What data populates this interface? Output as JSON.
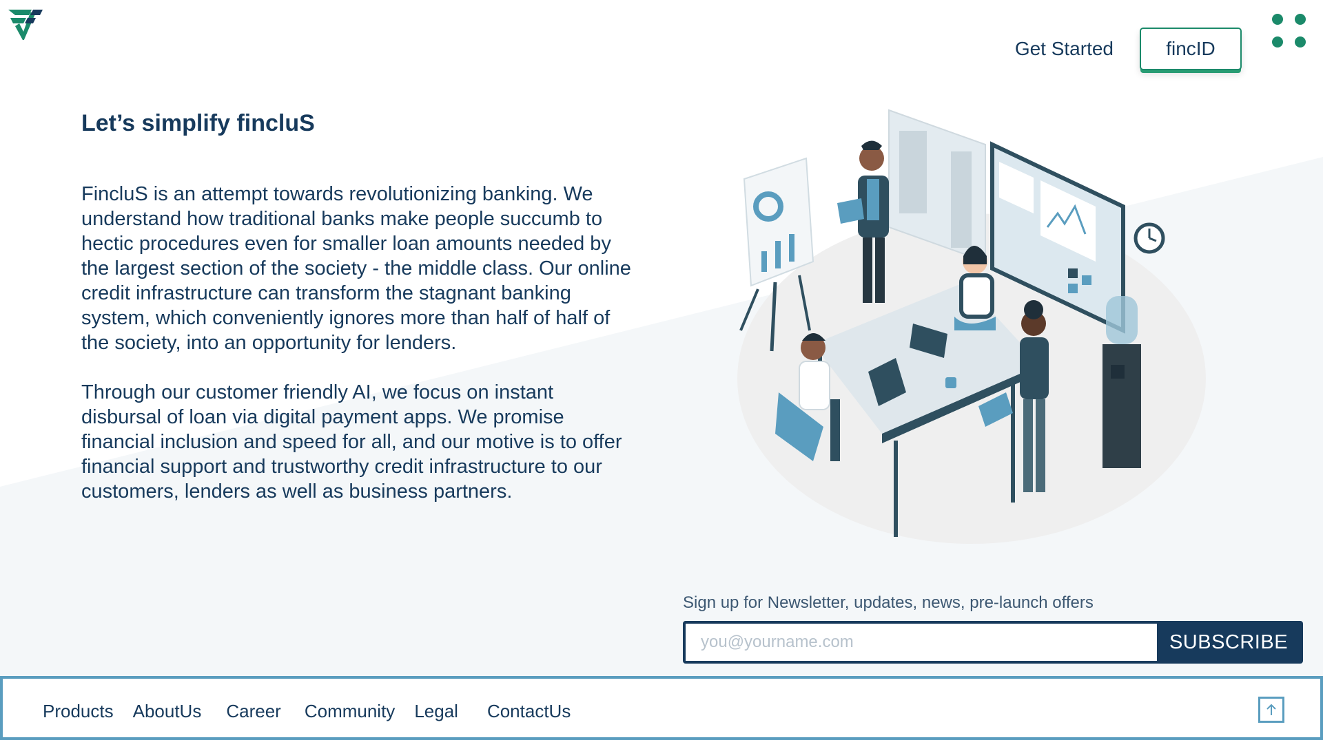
{
  "header": {
    "logo_icon": "finclus-logo-icon",
    "get_started": "Get Started",
    "fincid": "fincID",
    "menu_icon": "grid-menu-icon"
  },
  "main": {
    "headline": "Let’s simplify fincluS",
    "paragraph1": "FincluS is an attempt towards revolutionizing banking. We understand how traditional banks make people succumb to hectic procedures even for smaller loan amounts needed by the largest section of the society - the middle class. Our online credit infrastructure can transform the stagnant banking system, which conveniently ignores more than half of half of the society, into an opportunity for lenders.",
    "paragraph2": "Through our customer friendly AI, we focus on instant disbursal of loan via digital payment apps. We promise financial inclusion and speed for all, and our motive is to offer financial support and trustworthy credit infrastructure to our customers, lenders as well as business partners."
  },
  "newsletter": {
    "label": "Sign up for Newsletter, updates, news, pre-launch offers",
    "placeholder": "you@yourname.com",
    "value": "",
    "subscribe": "SUBSCRIBE"
  },
  "footer": {
    "links": [
      "Products",
      "AboutUs",
      "Career",
      "Community",
      "Legal",
      "ContactUs"
    ],
    "back_to_top_icon": "arrow-up-icon"
  },
  "colors": {
    "brand_green": "#1b8a6a",
    "navy": "#173a5c",
    "footer_border": "#5a9dbf",
    "background_tint": "#f4f7f9"
  }
}
